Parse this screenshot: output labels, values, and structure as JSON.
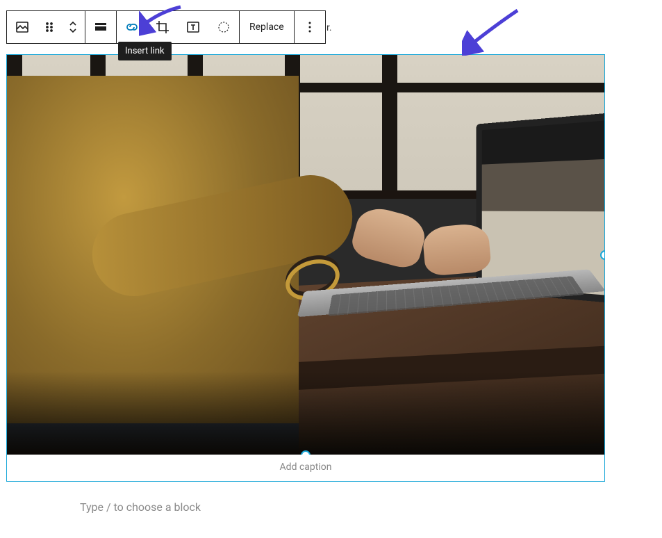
{
  "toolbar": {
    "block_icon": "image-icon",
    "drag_icon": "drag-handle-icon",
    "move_icon": "move-up-down-icon",
    "align_icon": "align-icon",
    "link_icon": "link-icon",
    "crop_icon": "crop-icon",
    "textoverlay_icon": "text-overlay-icon",
    "duotone_icon": "duotone-icon",
    "replace_label": "Replace",
    "more_icon": "more-options-icon"
  },
  "tooltip": {
    "link": "Insert link"
  },
  "background_text_fragment": "r.",
  "image_block": {
    "caption_placeholder": "Add caption"
  },
  "editor": {
    "prompt_placeholder": "Type / to choose a block"
  },
  "colors": {
    "selection": "#19a7d8",
    "arrow": "#4c3fd6",
    "link_active": "#007cba"
  }
}
